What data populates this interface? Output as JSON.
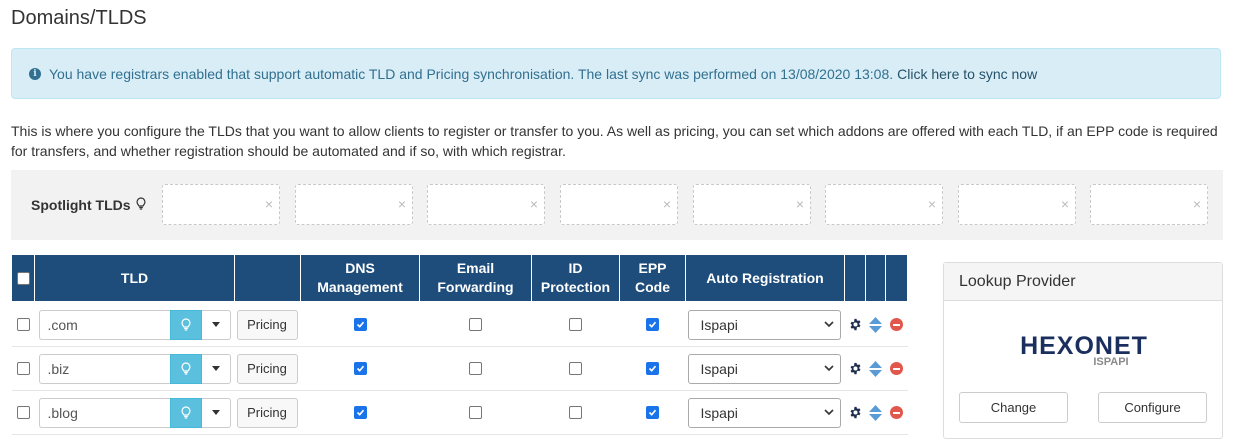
{
  "page": {
    "title": "Domains/TLDS"
  },
  "alert": {
    "icon": "info-circle-icon",
    "message": "You have registrars enabled that support automatic TLD and Pricing synchronisation. The last sync was performed on 13/08/2020 13:08.",
    "link": "Click here to sync now"
  },
  "intro": "This is where you configure the TLDs that you want to allow clients to register or transfer to you. As well as pricing, you can set which addons are offered with each TLD, if an EPP code is required for transfers, and whether registration should be automated and if so, with which registrar.",
  "spotlight": {
    "label": "Spotlight TLDs",
    "icon": "lightbulb-icon",
    "slots": [
      "",
      "",
      "",
      "",
      "",
      "",
      "",
      ""
    ],
    "remove_glyph": "×"
  },
  "table": {
    "headers": {
      "tld": "TLD",
      "dns_1": "DNS",
      "dns_2": "Management",
      "email_1": "Email",
      "email_2": "Forwarding",
      "id_1": "ID",
      "id_2": "Protection",
      "epp_1": "EPP",
      "epp_2": "Code",
      "auto": "Auto Registration"
    },
    "rows": [
      {
        "tld": ".com",
        "pricing": "Pricing",
        "dns": true,
        "email": false,
        "id": false,
        "epp": true,
        "registrar": "Ispapi",
        "selected": false
      },
      {
        "tld": ".biz",
        "pricing": "Pricing",
        "dns": true,
        "email": false,
        "id": false,
        "epp": true,
        "registrar": "Ispapi",
        "selected": false
      },
      {
        "tld": ".blog",
        "pricing": "Pricing",
        "dns": true,
        "email": false,
        "id": false,
        "epp": true,
        "registrar": "Ispapi",
        "selected": false
      }
    ]
  },
  "lookup": {
    "title": "Lookup Provider",
    "logo_main": "HEXONET",
    "logo_sub": "ISPAPI",
    "change": "Change",
    "configure": "Configure"
  },
  "colors": {
    "header_bg": "#1e4d7b",
    "alert_bg": "#d9edf7",
    "alert_text": "#31708f",
    "bulb_button": "#5bc0de",
    "remove": "#e2574c",
    "checkbox_on": "#1a73e8"
  }
}
